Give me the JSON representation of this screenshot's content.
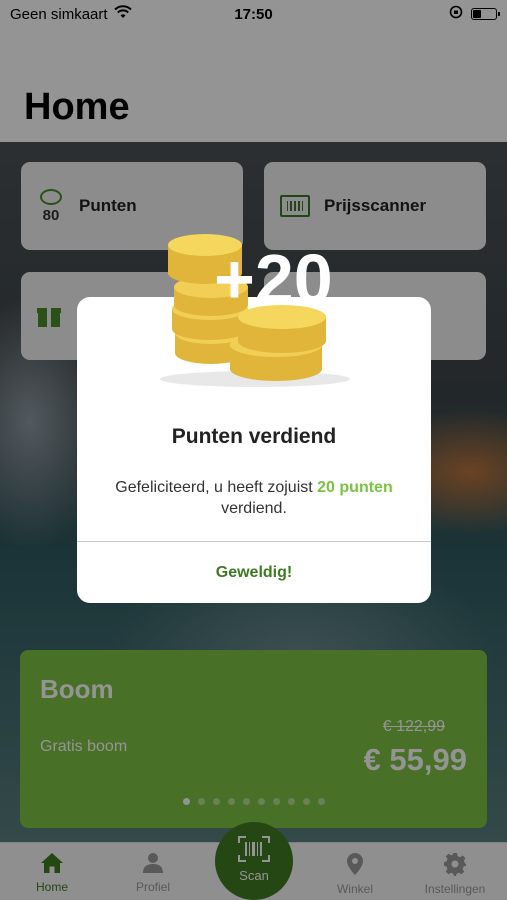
{
  "status_bar": {
    "carrier": "Geen simkaart",
    "time": "17:50",
    "battery_level": 0.35
  },
  "header": {
    "title": "Home"
  },
  "tiles": [
    {
      "label": "Punten",
      "icon": "points-icon",
      "points": "80"
    },
    {
      "label": "Prijsscanner",
      "icon": "barcode-scanner-icon"
    },
    {
      "label": "",
      "icon": "gift-icon"
    }
  ],
  "promo": {
    "title": "Boom",
    "subtitle": "Gratis boom",
    "old_price": "€ 122,99",
    "price": "€ 55,99",
    "page_count": 10,
    "active_page": 0
  },
  "tabbar": {
    "items": [
      {
        "label": "Home",
        "icon": "home-icon",
        "active": true
      },
      {
        "label": "Profiel",
        "icon": "person-icon",
        "active": false
      },
      {
        "label": "Scan",
        "icon": "barcode-scanner-icon",
        "active": false
      },
      {
        "label": "Winkel",
        "icon": "location-pin-icon",
        "active": false
      },
      {
        "label": "Instellingen",
        "icon": "gear-icon",
        "active": false
      }
    ]
  },
  "modal": {
    "badge": "+20",
    "title": "Punten verdiend",
    "message_before": "Gefeliciteerd, u heeft zojuist ",
    "message_highlight": "20 punten",
    "message_after": " verdiend.",
    "button_label": "Geweldig!"
  },
  "colors": {
    "accent": "#3f7a22",
    "brand_green": "#7cc242",
    "overlay": "rgba(0,0,0,0.42)"
  }
}
